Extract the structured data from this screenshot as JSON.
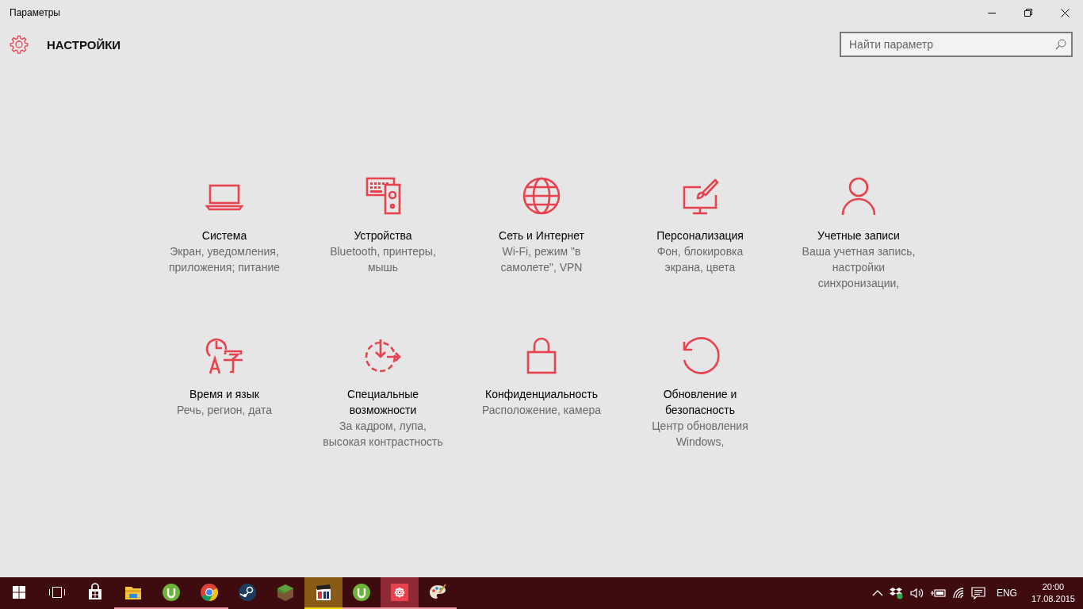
{
  "window": {
    "title": "Параметры"
  },
  "header": {
    "title": "НАСТРОЙКИ",
    "search": {
      "placeholder": "Найти параметр"
    }
  },
  "tiles": [
    {
      "kind": "system",
      "title": "Система",
      "description": "Экран, уведомления, приложения; питание"
    },
    {
      "kind": "devices",
      "title": "Устройства",
      "description": "Bluetooth, принтеры, мышь"
    },
    {
      "kind": "network",
      "title": "Сеть и Интернет",
      "description": "Wi-Fi, режим \"в самолете\", VPN"
    },
    {
      "kind": "personalization",
      "title": "Персонализация",
      "description": "Фон, блокировка экрана, цвета"
    },
    {
      "kind": "accounts",
      "title": "Учетные записи",
      "description": "Ваша учетная запись, настройки синхронизации,"
    },
    {
      "kind": "time",
      "title": "Время и язык",
      "description": "Речь, регион, дата"
    },
    {
      "kind": "ease",
      "title": "Специальные возможности",
      "description": "За кадром, лупа, высокая контрастность"
    },
    {
      "kind": "privacy",
      "title": "Конфиденциальность",
      "description": "Расположение, камера"
    },
    {
      "kind": "update",
      "title": "Обновление и безопасность",
      "description": "Центр обновления Windows,"
    }
  ],
  "taskbar": {
    "apps": [
      {
        "kind": "store",
        "running": false,
        "selected": false,
        "attention": false
      },
      {
        "kind": "explorer",
        "running": true,
        "selected": false,
        "attention": false
      },
      {
        "kind": "torrent",
        "running": true,
        "selected": false,
        "attention": false
      },
      {
        "kind": "browser",
        "running": true,
        "selected": false,
        "attention": false
      },
      {
        "kind": "steam",
        "running": false,
        "selected": false,
        "attention": false
      },
      {
        "kind": "block",
        "running": false,
        "selected": false,
        "attention": false
      },
      {
        "kind": "video",
        "running": true,
        "selected": false,
        "attention": true
      },
      {
        "kind": "torrent",
        "running": true,
        "selected": false,
        "attention": false
      },
      {
        "kind": "settings",
        "running": true,
        "selected": true,
        "attention": false
      },
      {
        "kind": "paint",
        "running": true,
        "selected": false,
        "attention": false
      }
    ],
    "tray": {
      "language": "ENG",
      "time": "20:00",
      "date": "17.08.2015"
    }
  }
}
